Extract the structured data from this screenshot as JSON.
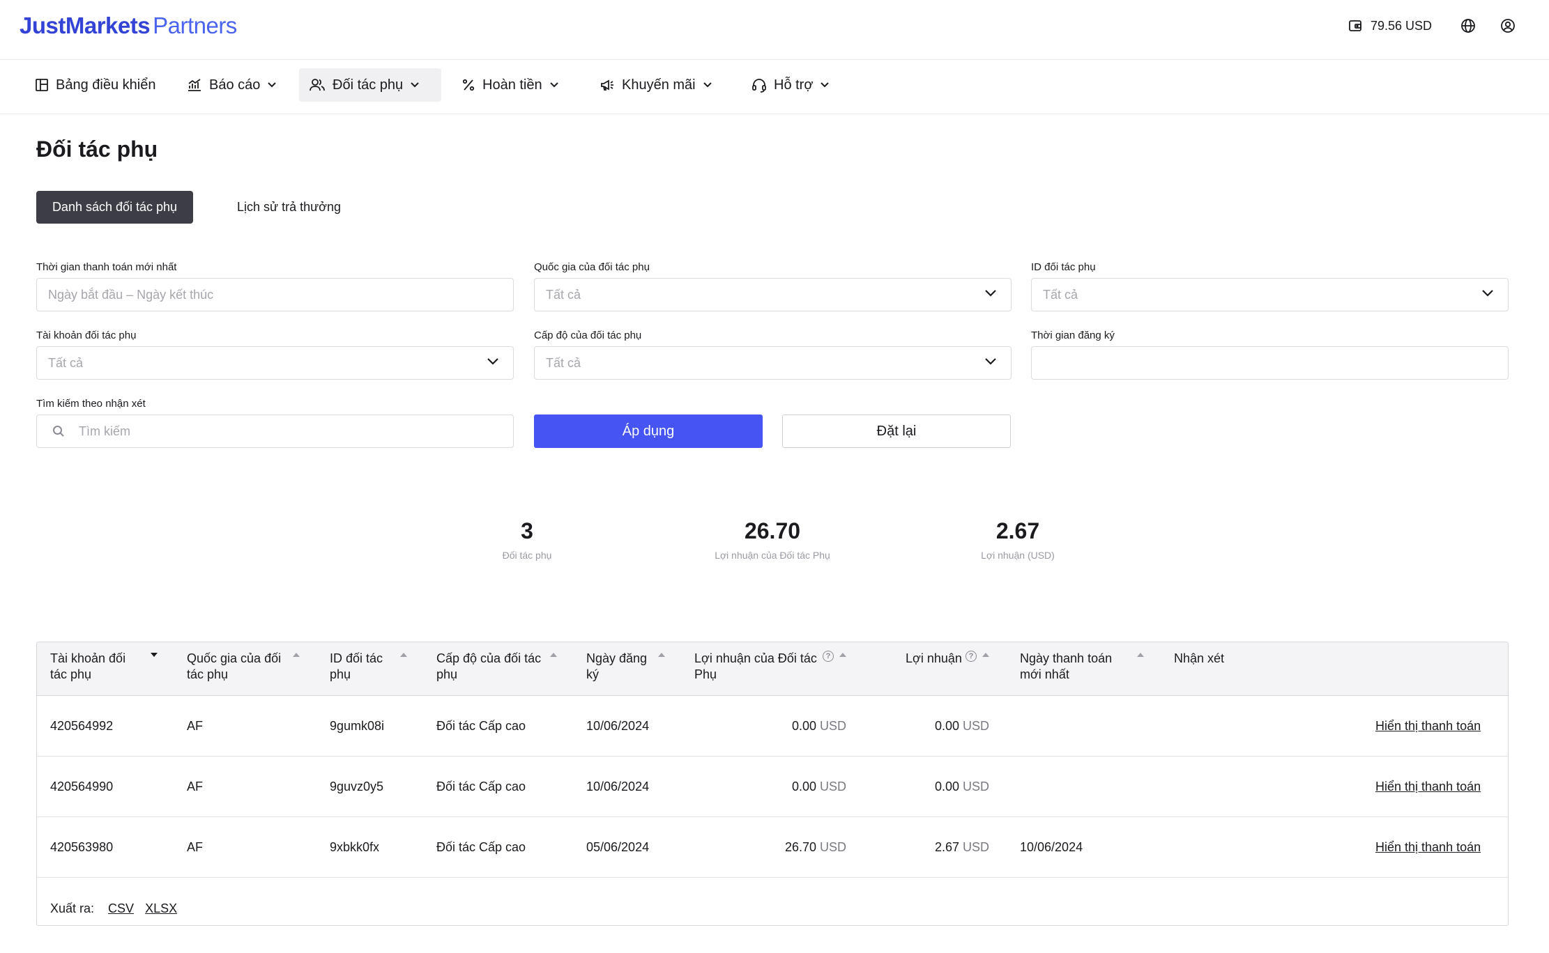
{
  "header": {
    "brand": "JustMarkets",
    "brand_sub": "Partners",
    "balance": "79.56 USD"
  },
  "nav": {
    "items": [
      {
        "label": "Bảng điều khiển",
        "icon": "layout-icon",
        "has_dropdown": false
      },
      {
        "label": "Báo cáo",
        "icon": "chart-icon",
        "has_dropdown": true
      },
      {
        "label": "Đối tác phụ",
        "icon": "users-icon",
        "has_dropdown": true,
        "active": true
      },
      {
        "label": "Hoàn tiền",
        "icon": "percent-icon",
        "has_dropdown": true
      },
      {
        "label": "Khuyến mãi",
        "icon": "megaphone-icon",
        "has_dropdown": true
      },
      {
        "label": "Hỗ trợ",
        "icon": "headset-icon",
        "has_dropdown": true
      }
    ]
  },
  "page": {
    "title": "Đối tác phụ",
    "tabs": [
      "Danh sách đối tác phụ",
      "Lịch sử trả thưởng"
    ]
  },
  "filters": {
    "last_payment_label": "Thời gian thanh toán mới nhất",
    "last_payment_placeholder": "Ngày bắt đầu – Ngày kết thúc",
    "country_label": "Quốc gia của đối tác phụ",
    "country_value": "Tất cả",
    "id_label": "ID đối tác phụ",
    "id_value": "Tất cả",
    "account_label": "Tài khoản đối tác phụ",
    "account_value": "Tất cả",
    "level_label": "Cấp độ của đối tác phụ",
    "level_value": "Tất cả",
    "reg_label": "Thời gian đăng ký",
    "reg_value": "",
    "search_label": "Tìm kiếm theo nhận xét",
    "search_placeholder": "Tìm kiếm",
    "apply": "Áp dụng",
    "reset": "Đặt lại"
  },
  "stats": [
    {
      "value": "3",
      "label": "Đối tác phụ"
    },
    {
      "value": "26.70",
      "label": "Lợi nhuận của Đối tác Phụ"
    },
    {
      "value": "2.67",
      "label": "Lợi nhuận (USD)"
    }
  ],
  "table": {
    "columns": [
      "Tài khoản đối tác phụ",
      "Quốc gia của đối tác phụ",
      "ID đối tác phụ",
      "Cấp độ của đối tác phụ",
      "Ngày đăng ký",
      "Lợi nhuận của Đối tác Phụ",
      "Lợi nhuận",
      "Ngày thanh toán mới nhất",
      "Nhận xét"
    ],
    "currency": "USD",
    "link_text": "Hiển thị thanh toán",
    "rows": [
      {
        "account": "420564992",
        "country": "AF",
        "id": "9gumk08i",
        "level": "Đối tác Cấp cao",
        "reg_date": "10/06/2024",
        "sub_profit": "0.00",
        "profit": "0.00",
        "last_payment": "",
        "comment": ""
      },
      {
        "account": "420564990",
        "country": "AF",
        "id": "9guvz0y5",
        "level": "Đối tác Cấp cao",
        "reg_date": "10/06/2024",
        "sub_profit": "0.00",
        "profit": "0.00",
        "last_payment": "",
        "comment": ""
      },
      {
        "account": "420563980",
        "country": "AF",
        "id": "9xbkk0fx",
        "level": "Đối tác Cấp cao",
        "reg_date": "05/06/2024",
        "sub_profit": "26.70",
        "profit": "2.67",
        "last_payment": "10/06/2024",
        "comment": ""
      }
    ],
    "export_label": "Xuất ra:",
    "export_csv": "CSV",
    "export_xlsx": "XLSX"
  },
  "colors": {
    "brand": "#3343d6",
    "primary_button": "#4554f2",
    "active_tab": "#3d3d45"
  }
}
